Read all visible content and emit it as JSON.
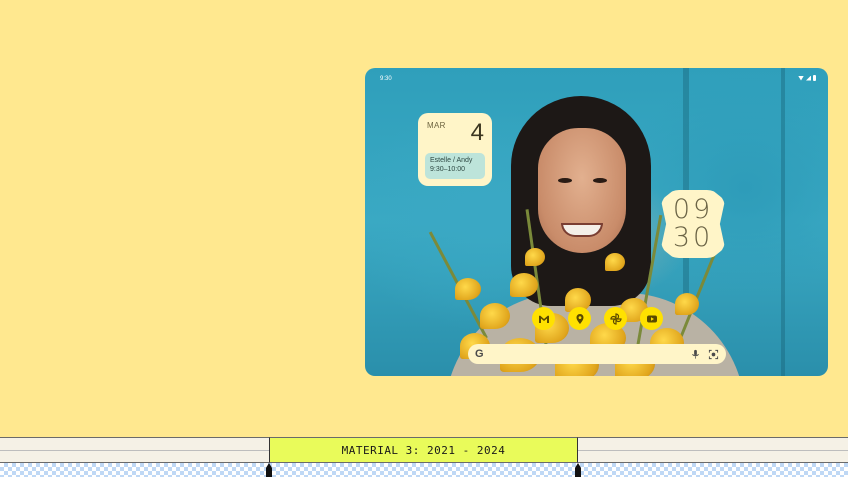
{
  "status_bar": {
    "time": "9:30",
    "icons": [
      "wifi-icon",
      "signal-icon",
      "battery-icon"
    ]
  },
  "calendar_widget": {
    "month": "MAR",
    "day": "4",
    "event_title": "Estelle / Andy",
    "event_time": "9:30–10:00"
  },
  "clock_widget": {
    "hours": "09",
    "minutes": "30"
  },
  "dock": {
    "apps": [
      {
        "name": "gmail-icon"
      },
      {
        "name": "maps-icon"
      },
      {
        "name": "pinwheel-icon"
      },
      {
        "name": "youtube-icon"
      }
    ]
  },
  "search_bar": {
    "logo": "G",
    "icons": [
      "mic-icon",
      "lens-icon"
    ]
  },
  "timeline": {
    "era_label": "MATERIAL 3: 2021 - 2024"
  },
  "colors": {
    "page_background": "#FFE88F",
    "widget_surface": "#FFF5C8",
    "event_chip": "#BDE4DA",
    "app_icon": "#FFE100",
    "era_highlight": "#E9FB5A",
    "checker": "#BFD8F5"
  }
}
